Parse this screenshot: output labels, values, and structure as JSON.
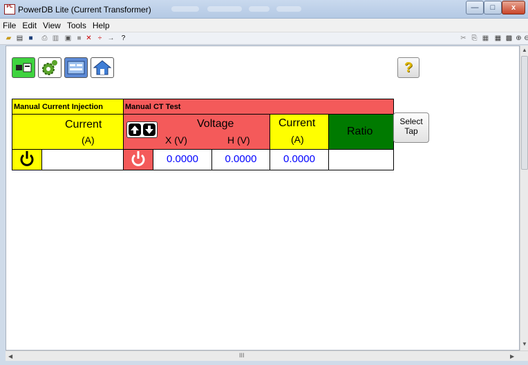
{
  "window": {
    "title": "PowerDB Lite (Current Transformer)",
    "app_badge": "PL",
    "controls": {
      "minimize": "—",
      "maximize": "□",
      "close": "x"
    }
  },
  "menu": [
    "File",
    "Edit",
    "View",
    "Tools",
    "Help"
  ],
  "manual_injection": {
    "header": "Manual Current Injection",
    "current_label": "Current",
    "current_unit": "(A)",
    "current_value": ""
  },
  "ct_test": {
    "header": "Manual CT Test",
    "voltage_label": "Voltage",
    "x_label": "X (V)",
    "h_label": "H (V)",
    "current_label": "Current",
    "current_unit": "(A)",
    "ratio_label": "Ratio",
    "x_value": "0.0000",
    "h_value": "0.0000",
    "current_value": "0.0000",
    "ratio_value": ""
  },
  "select_tap": {
    "line1": "Select",
    "line2": "Tap"
  },
  "help_button": "?",
  "scroll": {
    "h_center": "III"
  },
  "colors": {
    "yellow": "#ffff00",
    "red": "#f45a5a",
    "green": "#007a00",
    "value_blue": "#0000ff"
  }
}
